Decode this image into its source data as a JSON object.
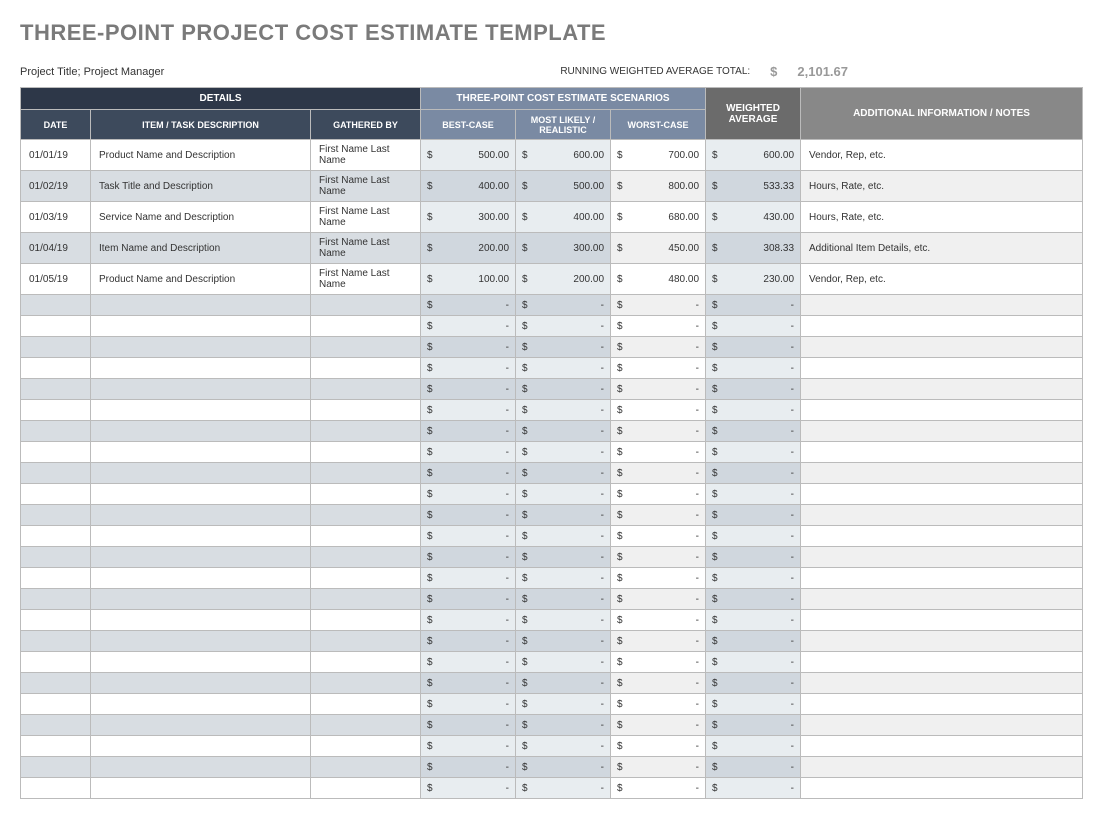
{
  "title": "THREE-POINT PROJECT COST ESTIMATE TEMPLATE",
  "project_title": "Project Title; Project Manager",
  "running_total_label": "RUNNING WEIGHTED AVERAGE TOTAL:",
  "running_total_currency": "$",
  "running_total_value": "2,101.67",
  "headers": {
    "details": "DETAILS",
    "scenarios": "THREE-POINT COST ESTIMATE SCENARIOS",
    "weighted": "WEIGHTED AVERAGE",
    "notes": "ADDITIONAL INFORMATION / NOTES",
    "date": "DATE",
    "item": "ITEM / TASK DESCRIPTION",
    "gathered": "GATHERED BY",
    "best": "BEST-CASE",
    "likely": "MOST LIKELY / REALISTIC",
    "worst": "WORST-CASE"
  },
  "rows": [
    {
      "date": "01/01/19",
      "item": "Product Name and Description",
      "gathered": "First Name Last Name",
      "best": "500.00",
      "likely": "600.00",
      "worst": "700.00",
      "weighted": "600.00",
      "notes": "Vendor, Rep, etc."
    },
    {
      "date": "01/02/19",
      "item": "Task Title and Description",
      "gathered": "First Name Last Name",
      "best": "400.00",
      "likely": "500.00",
      "worst": "800.00",
      "weighted": "533.33",
      "notes": "Hours, Rate, etc."
    },
    {
      "date": "01/03/19",
      "item": "Service Name and Description",
      "gathered": "First Name Last Name",
      "best": "300.00",
      "likely": "400.00",
      "worst": "680.00",
      "weighted": "430.00",
      "notes": "Hours, Rate, etc."
    },
    {
      "date": "01/04/19",
      "item": "Item Name and Description",
      "gathered": "First Name Last Name",
      "best": "200.00",
      "likely": "300.00",
      "worst": "450.00",
      "weighted": "308.33",
      "notes": "Additional Item Details, etc."
    },
    {
      "date": "01/05/19",
      "item": "Product Name and Description",
      "gathered": "First Name Last Name",
      "best": "100.00",
      "likely": "200.00",
      "worst": "480.00",
      "weighted": "230.00",
      "notes": "Vendor, Rep, etc."
    },
    {
      "date": "",
      "item": "",
      "gathered": "",
      "best": "-",
      "likely": "-",
      "worst": "-",
      "weighted": "-",
      "notes": ""
    },
    {
      "date": "",
      "item": "",
      "gathered": "",
      "best": "-",
      "likely": "-",
      "worst": "-",
      "weighted": "-",
      "notes": ""
    },
    {
      "date": "",
      "item": "",
      "gathered": "",
      "best": "-",
      "likely": "-",
      "worst": "-",
      "weighted": "-",
      "notes": ""
    },
    {
      "date": "",
      "item": "",
      "gathered": "",
      "best": "-",
      "likely": "-",
      "worst": "-",
      "weighted": "-",
      "notes": ""
    },
    {
      "date": "",
      "item": "",
      "gathered": "",
      "best": "-",
      "likely": "-",
      "worst": "-",
      "weighted": "-",
      "notes": ""
    },
    {
      "date": "",
      "item": "",
      "gathered": "",
      "best": "-",
      "likely": "-",
      "worst": "-",
      "weighted": "-",
      "notes": ""
    },
    {
      "date": "",
      "item": "",
      "gathered": "",
      "best": "-",
      "likely": "-",
      "worst": "-",
      "weighted": "-",
      "notes": ""
    },
    {
      "date": "",
      "item": "",
      "gathered": "",
      "best": "-",
      "likely": "-",
      "worst": "-",
      "weighted": "-",
      "notes": ""
    },
    {
      "date": "",
      "item": "",
      "gathered": "",
      "best": "-",
      "likely": "-",
      "worst": "-",
      "weighted": "-",
      "notes": ""
    },
    {
      "date": "",
      "item": "",
      "gathered": "",
      "best": "-",
      "likely": "-",
      "worst": "-",
      "weighted": "-",
      "notes": ""
    },
    {
      "date": "",
      "item": "",
      "gathered": "",
      "best": "-",
      "likely": "-",
      "worst": "-",
      "weighted": "-",
      "notes": ""
    },
    {
      "date": "",
      "item": "",
      "gathered": "",
      "best": "-",
      "likely": "-",
      "worst": "-",
      "weighted": "-",
      "notes": ""
    },
    {
      "date": "",
      "item": "",
      "gathered": "",
      "best": "-",
      "likely": "-",
      "worst": "-",
      "weighted": "-",
      "notes": ""
    },
    {
      "date": "",
      "item": "",
      "gathered": "",
      "best": "-",
      "likely": "-",
      "worst": "-",
      "weighted": "-",
      "notes": ""
    },
    {
      "date": "",
      "item": "",
      "gathered": "",
      "best": "-",
      "likely": "-",
      "worst": "-",
      "weighted": "-",
      "notes": ""
    },
    {
      "date": "",
      "item": "",
      "gathered": "",
      "best": "-",
      "likely": "-",
      "worst": "-",
      "weighted": "-",
      "notes": ""
    },
    {
      "date": "",
      "item": "",
      "gathered": "",
      "best": "-",
      "likely": "-",
      "worst": "-",
      "weighted": "-",
      "notes": ""
    },
    {
      "date": "",
      "item": "",
      "gathered": "",
      "best": "-",
      "likely": "-",
      "worst": "-",
      "weighted": "-",
      "notes": ""
    },
    {
      "date": "",
      "item": "",
      "gathered": "",
      "best": "-",
      "likely": "-",
      "worst": "-",
      "weighted": "-",
      "notes": ""
    },
    {
      "date": "",
      "item": "",
      "gathered": "",
      "best": "-",
      "likely": "-",
      "worst": "-",
      "weighted": "-",
      "notes": ""
    },
    {
      "date": "",
      "item": "",
      "gathered": "",
      "best": "-",
      "likely": "-",
      "worst": "-",
      "weighted": "-",
      "notes": ""
    },
    {
      "date": "",
      "item": "",
      "gathered": "",
      "best": "-",
      "likely": "-",
      "worst": "-",
      "weighted": "-",
      "notes": ""
    },
    {
      "date": "",
      "item": "",
      "gathered": "",
      "best": "-",
      "likely": "-",
      "worst": "-",
      "weighted": "-",
      "notes": ""
    },
    {
      "date": "",
      "item": "",
      "gathered": "",
      "best": "-",
      "likely": "-",
      "worst": "-",
      "weighted": "-",
      "notes": ""
    }
  ]
}
